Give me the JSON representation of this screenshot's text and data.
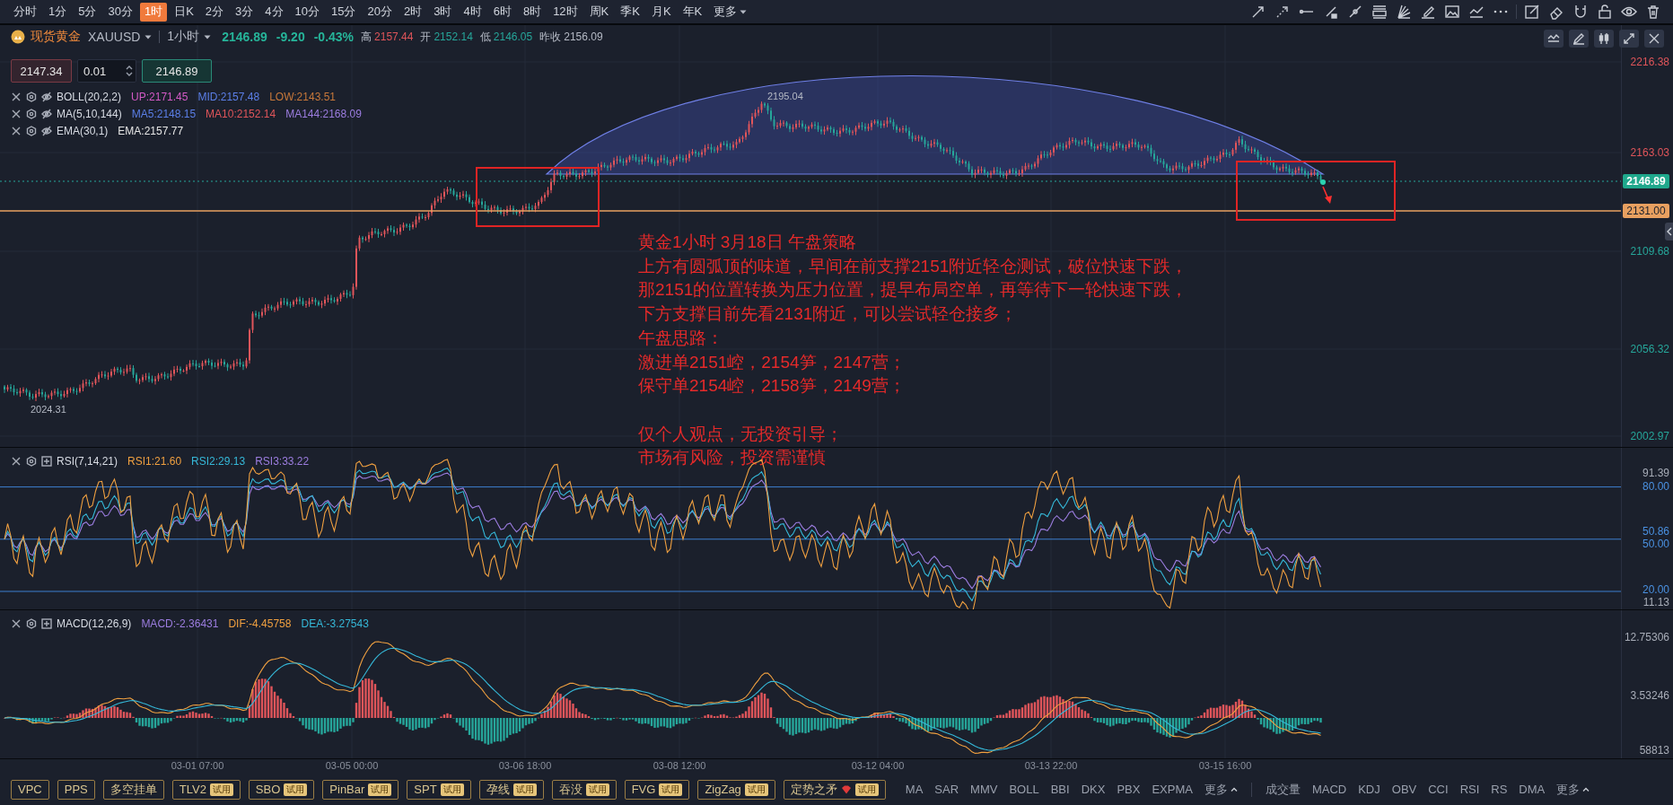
{
  "timeframes": [
    {
      "label": "分时",
      "selected": false
    },
    {
      "label": "1分",
      "selected": false
    },
    {
      "label": "5分",
      "selected": false
    },
    {
      "label": "30分",
      "selected": false
    },
    {
      "label": "1时",
      "selected": true
    },
    {
      "label": "日K",
      "selected": false
    },
    {
      "label": "2分",
      "selected": false
    },
    {
      "label": "3分",
      "selected": false
    },
    {
      "label": "4分",
      "selected": false
    },
    {
      "label": "10分",
      "selected": false
    },
    {
      "label": "15分",
      "selected": false
    },
    {
      "label": "20分",
      "selected": false
    },
    {
      "label": "2时",
      "selected": false
    },
    {
      "label": "3时",
      "selected": false
    },
    {
      "label": "4时",
      "selected": false
    },
    {
      "label": "6时",
      "selected": false
    },
    {
      "label": "8时",
      "selected": false
    },
    {
      "label": "12时",
      "selected": false
    },
    {
      "label": "周K",
      "selected": false
    },
    {
      "label": "季K",
      "selected": false
    },
    {
      "label": "月K",
      "selected": false
    },
    {
      "label": "年K",
      "selected": false
    }
  ],
  "timeframes_more": "更多",
  "header": {
    "symbol": "现货黄金",
    "code": "XAUUSD",
    "period": "1小时",
    "price": "2146.89",
    "change": "-9.20",
    "change_pct": "-0.43%",
    "stats": [
      {
        "label": "高",
        "value": "2157.44",
        "color": "#e0555a"
      },
      {
        "label": "开",
        "value": "2152.14",
        "color": "#26a69a"
      },
      {
        "label": "低",
        "value": "2146.05",
        "color": "#26a69a"
      },
      {
        "label": "昨收",
        "value": "2156.09",
        "color": "#b4b9c4"
      }
    ]
  },
  "order": {
    "sell": "2147.34",
    "quantity": "0.01",
    "buy": "2146.89"
  },
  "indicators": [
    {
      "name": "BOLL(20,2,2)",
      "values": [
        {
          "text": "UP:2171.45",
          "color": "#d45ac6"
        },
        {
          "text": "MID:2157.48",
          "color": "#5b7fe8"
        },
        {
          "text": "LOW:2143.51",
          "color": "#c8783a"
        }
      ]
    },
    {
      "name": "MA(5,10,144)",
      "values": [
        {
          "text": "MA5:2148.15",
          "color": "#5b7fe8"
        },
        {
          "text": "MA10:2152.14",
          "color": "#e0555a"
        },
        {
          "text": "MA144:2168.09",
          "color": "#9c7de0"
        }
      ]
    },
    {
      "name": "EMA(30,1)",
      "values": [
        {
          "text": "EMA:2157.77",
          "color": "#e6e6e6"
        }
      ]
    }
  ],
  "price_axis": [
    {
      "label": "2216.38",
      "color": "#e0555a"
    },
    {
      "label": "2163.03",
      "color": "#e0555a"
    },
    {
      "label": "2109.68",
      "color": "#26a69a"
    },
    {
      "label": "2056.32",
      "color": "#26a69a"
    },
    {
      "label": "2002.97",
      "color": "#26a69a"
    }
  ],
  "last_price_badge": "2146.89",
  "level_badge": "2131.00",
  "chart_labels": {
    "high": "2195.04",
    "low": "2024.31"
  },
  "annotation": {
    "paragraphs": [
      [
        "黄金1小时 3月18日 午盘策略",
        "上方有圆弧顶的味道，早间在前支撑2151附近轻仓测试，破位快速下跌，",
        "那2151的位置转换为压力位置，提早布局空单，再等待下一轮快速下跌，",
        "下方支撑目前先看2131附近，可以尝试轻仓接多；",
        "午盘思路：",
        "激进单2151崆，2154笋，2147营；",
        "保守单2154崆，2158笋，2149营；"
      ],
      [
        "仅个人观点，无投资引导；",
        "市场有风险，投资需谨慎"
      ]
    ]
  },
  "rsi": {
    "name": "RSI(7,14,21)",
    "values": [
      {
        "text": "RSI1:21.60",
        "color": "#f0a040"
      },
      {
        "text": "RSI2:29.13",
        "color": "#35b8d8"
      },
      {
        "text": "RSI3:33.22",
        "color": "#9c7de0"
      }
    ],
    "axis": [
      {
        "label": "91.39",
        "color": "#a8adb8"
      },
      {
        "label": "80.00",
        "color": "#4a90e0"
      },
      {
        "label": "50.86",
        "color": "#4a90e0"
      },
      {
        "label": "50.00",
        "color": "#4a90e0"
      },
      {
        "label": "20.00",
        "color": "#4a90e0"
      },
      {
        "label": "11.13",
        "color": "#a8adb8"
      }
    ]
  },
  "macd": {
    "name": "MACD(12,26,9)",
    "values": [
      {
        "text": "MACD:-2.36431",
        "color": "#9c7de0"
      },
      {
        "text": "DIF:-4.45758",
        "color": "#f0a040"
      },
      {
        "text": "DEA:-3.27543",
        "color": "#35b8d8"
      }
    ],
    "axis": [
      {
        "label": "12.75306",
        "color": "#a8adb8"
      },
      {
        "label": "3.53246",
        "color": "#a8adb8"
      },
      {
        "label": "58813",
        "color": "#a8adb8"
      }
    ]
  },
  "time_axis": [
    "03-01 07:00",
    "03-05 00:00",
    "03-06 18:00",
    "03-08 12:00",
    "03-12 04:00",
    "03-13 22:00",
    "03-15 16:00"
  ],
  "bottom": {
    "strategies": [
      {
        "label": "VPC"
      },
      {
        "label": "PPS"
      },
      {
        "label": "多空挂单"
      },
      {
        "label": "TLV2",
        "badge": "试用"
      },
      {
        "label": "SBO",
        "badge": "试用"
      },
      {
        "label": "PinBar",
        "badge": "试用"
      },
      {
        "label": "SPT",
        "badge": "试用"
      },
      {
        "label": "孕线",
        "badge": "试用"
      },
      {
        "label": "吞没",
        "badge": "试用"
      },
      {
        "label": "FVG",
        "badge": "试用"
      },
      {
        "label": "ZigZag",
        "badge": "试用"
      },
      {
        "label": "定势之矛",
        "badge": "试用",
        "hot": true
      }
    ],
    "overlays": [
      "MA",
      "SAR",
      "MMV",
      "BOLL",
      "BBI",
      "DKX",
      "PBX",
      "EXPMA"
    ],
    "overlays_more": "更多",
    "studies": [
      "成交量",
      "MACD",
      "KDJ",
      "OBV",
      "CCI",
      "RSI",
      "RS",
      "DMA"
    ],
    "studies_more": "更多"
  }
}
